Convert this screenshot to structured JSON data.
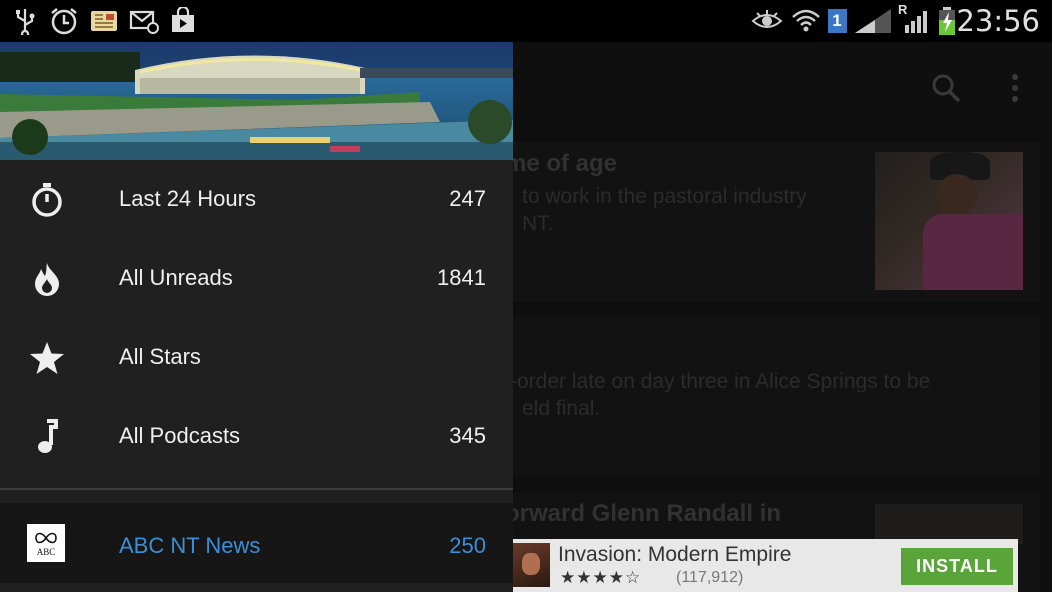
{
  "status_bar": {
    "time": "23:56",
    "sim_badge": "1",
    "roaming": "R",
    "icons": [
      "usb-icon",
      "alarm-icon",
      "newspaper-icon",
      "mail-icon",
      "store-bag-icon",
      "eye-icon",
      "wifi-icon",
      "signal-icon",
      "battery-charging-icon"
    ]
  },
  "background": {
    "articles": [
      {
        "title_fragment": "me of age",
        "text_lines": [
          "to work in the pastoral industry",
          "NT."
        ]
      },
      {
        "title_fragment": "",
        "text_lines": [
          "-order late on day three in Alice Springs to be",
          "eld final."
        ]
      },
      {
        "title_fragment": "orward Glenn Randall in",
        "text_lines": []
      }
    ],
    "actions": [
      "search-icon",
      "overflow-menu-icon"
    ]
  },
  "ad": {
    "title": "Invasion: Modern Empire",
    "stars": "★★★★☆",
    "reviews": "(117,912)",
    "install_label": "INSTALL"
  },
  "drawer": {
    "items": [
      {
        "label": "Last 24 Hours",
        "count": "247",
        "icon": "stopwatch-icon"
      },
      {
        "label": "All Unreads",
        "count": "1841",
        "icon": "flame-icon"
      },
      {
        "label": "All Stars",
        "count": "",
        "icon": "star-icon"
      },
      {
        "label": "All Podcasts",
        "count": "345",
        "icon": "music-note-icon"
      }
    ],
    "feed": {
      "label": "ABC NT News",
      "count": "250",
      "logo_text": "ABC"
    }
  },
  "colors": {
    "accent": "#3a8fd8",
    "install": "#5aa53a",
    "drawer_bg": "#202020"
  }
}
